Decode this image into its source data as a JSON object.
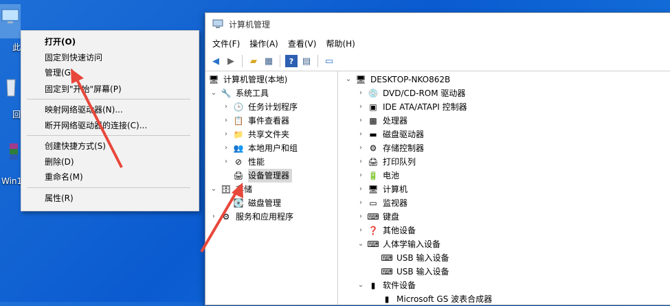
{
  "desktop": {
    "icons": [
      {
        "label": "此",
        "icon": "this-pc-icon"
      },
      {
        "label": "回",
        "icon": "recycle-bin-icon"
      },
      {
        "label": "Win1",
        "icon": "winrar-icon"
      }
    ]
  },
  "context_menu": {
    "items": [
      {
        "label": "打开(O)",
        "bold": true
      },
      {
        "label": "固定到快速访问"
      },
      {
        "label": "管理(G)"
      },
      {
        "label": "固定到\"开始\"屏幕(P)"
      },
      {
        "label": "映射网络驱动器(N)..."
      },
      {
        "label": "断开网络驱动器的连接(C)..."
      },
      {
        "label": "创建快捷方式(S)"
      },
      {
        "label": "删除(D)"
      },
      {
        "label": "重命名(M)"
      },
      {
        "label": "属性(R)"
      }
    ]
  },
  "window": {
    "title": "计算机管理",
    "menus": [
      "文件(F)",
      "操作(A)",
      "查看(V)",
      "帮助(H)"
    ],
    "tree": {
      "root": "计算机管理(本地)",
      "system_tools": "系统工具",
      "task_scheduler": "任务计划程序",
      "event_viewer": "事件查看器",
      "shared_folders": "共享文件夹",
      "local_users": "本地用户和组",
      "performance": "性能",
      "device_manager": "设备管理器",
      "storage": "存储",
      "disk_management": "磁盘管理",
      "services_apps": "服务和应用程序"
    },
    "devices": {
      "computer": "DESKTOP-NKO862B",
      "items": [
        "DVD/CD-ROM 驱动器",
        "IDE ATA/ATAPI 控制器",
        "处理器",
        "磁盘驱动器",
        "存储控制器",
        "打印队列",
        "电池",
        "计算机",
        "监视器",
        "键盘",
        "其他设备",
        "人体学输入设备",
        "USB 输入设备",
        "USB 输入设备",
        "软件设备",
        "Microsoft GS 波表合成器"
      ]
    }
  },
  "colors": {
    "arrow": "#e8473b",
    "desktop": "#0a5bd0"
  }
}
